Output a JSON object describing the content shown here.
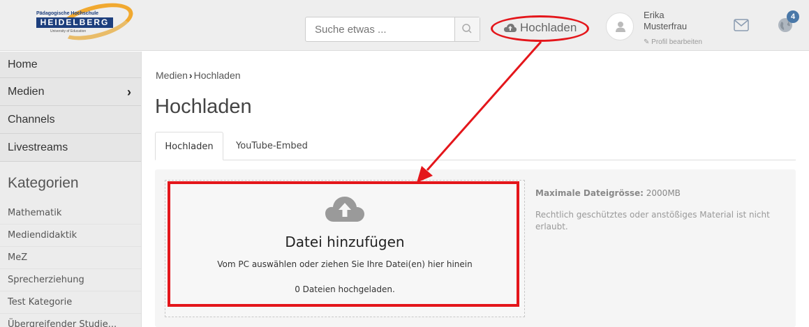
{
  "header": {
    "logo": {
      "top_line": "Pädagogische Hochschule",
      "name": "HEIDELBERG",
      "tagline": "University of Education"
    },
    "search": {
      "placeholder": "Suche etwas ..."
    },
    "upload_label": "Hochladen",
    "user": {
      "first_name": "Erika",
      "last_name": "Musterfrau",
      "edit_label": "Profil bearbeiten"
    },
    "notification_count": "4"
  },
  "sidebar": {
    "nav": [
      {
        "label": "Home"
      },
      {
        "label": "Medien",
        "has_submenu": true
      },
      {
        "label": "Channels"
      },
      {
        "label": "Livestreams"
      }
    ],
    "categories_title": "Kategorien",
    "categories": [
      "Mathematik",
      "Mediendidaktik",
      "MeZ",
      "Sprecherziehung",
      "Test Kategorie",
      "Übergreifender Studie..."
    ]
  },
  "main": {
    "breadcrumb": {
      "parent": "Medien",
      "current": "Hochladen"
    },
    "title": "Hochladen",
    "tabs": [
      {
        "label": "Hochladen",
        "active": true
      },
      {
        "label": "YouTube-Embed",
        "active": false
      }
    ],
    "dropzone": {
      "title": "Datei hinzufügen",
      "subtitle": "Vom PC auswählen oder ziehen Sie Ihre Datei(en) hier hinein",
      "count_text": "0 Dateien hochgeladen."
    },
    "info": {
      "max_size_label": "Maximale Dateigrösse:",
      "max_size_value": "2000MB",
      "legal_note": "Rechtlich geschütztes oder anstößiges Material ist nicht erlaubt."
    }
  },
  "colors": {
    "annotation_red": "#e4161b",
    "cloud_gray": "#9a9a9a",
    "badge_blue": "#4a78a8"
  }
}
